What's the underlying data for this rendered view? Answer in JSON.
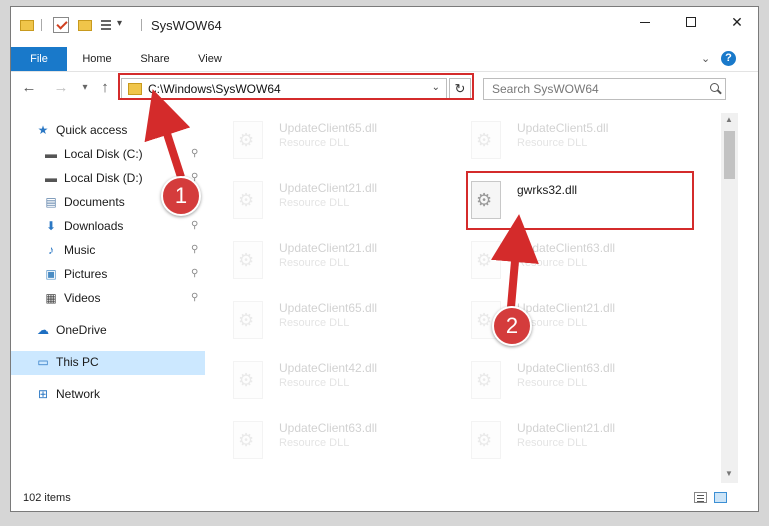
{
  "window": {
    "title": "SysWOW64"
  },
  "ribbon": {
    "tabs": [
      "File",
      "Home",
      "Share",
      "View"
    ],
    "help": "?"
  },
  "navigation": {
    "address": "C:\\Windows\\SysWOW64",
    "search_placeholder": "Search SysWOW64"
  },
  "sidebar": {
    "items": [
      {
        "label": "Quick access",
        "icon": "star-icon",
        "pinned": false
      },
      {
        "label": "Local Disk (C:)",
        "icon": "drive-icon",
        "pinned": true
      },
      {
        "label": "Local Disk (D:)",
        "icon": "drive-icon",
        "pinned": true
      },
      {
        "label": "Documents",
        "icon": "documents-icon",
        "pinned": true
      },
      {
        "label": "Downloads",
        "icon": "download-icon",
        "pinned": true
      },
      {
        "label": "Music",
        "icon": "music-icon",
        "pinned": true
      },
      {
        "label": "Pictures",
        "icon": "pictures-icon",
        "pinned": true
      },
      {
        "label": "Videos",
        "icon": "videos-icon",
        "pinned": true
      },
      {
        "label": "OneDrive",
        "icon": "cloud-icon",
        "pinned": false
      },
      {
        "label": "This PC",
        "icon": "computer-icon",
        "pinned": false,
        "selected": true
      },
      {
        "label": "Network",
        "icon": "network-icon",
        "pinned": false
      }
    ]
  },
  "files": {
    "left": [
      {
        "name": "UpdateClient65.dll",
        "type": "Resource DLL"
      },
      {
        "name": "UpdateClient21.dll",
        "type": "Resource DLL"
      },
      {
        "name": "UpdateClient21.dll",
        "type": "Resource DLL"
      },
      {
        "name": "UpdateClient65.dll",
        "type": "Resource DLL"
      },
      {
        "name": "UpdateClient42.dll",
        "type": "Resource DLL"
      },
      {
        "name": "UpdateClient63.dll",
        "type": "Resource DLL"
      }
    ],
    "right": [
      {
        "name": "UpdateClient5.dll",
        "type": "Resource DLL"
      },
      {
        "name": "gwrks32.dll",
        "type": "",
        "highlighted": true
      },
      {
        "name": "UpdateClient63.dll",
        "type": "Resource DLL"
      },
      {
        "name": "UpdateClient21.dll",
        "type": "Resource DLL"
      },
      {
        "name": "UpdateClient63.dll",
        "type": "Resource DLL"
      },
      {
        "name": "UpdateClient21.dll",
        "type": "Resource DLL"
      }
    ]
  },
  "status": {
    "count": "102 items"
  },
  "annotations": {
    "step1": "1",
    "step2": "2",
    "color": "#d42b2b"
  }
}
